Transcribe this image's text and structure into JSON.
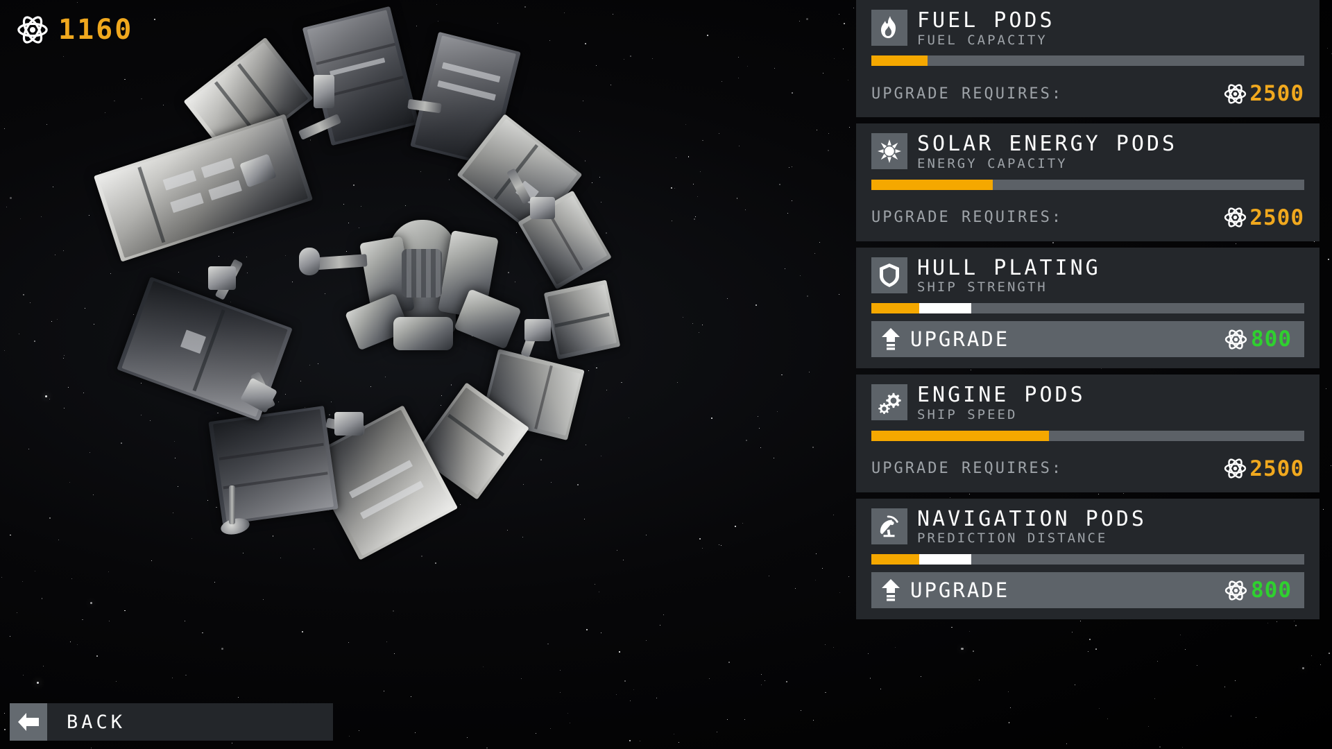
{
  "hud": {
    "currency_icon": "atom-icon",
    "currency_amount": "1160"
  },
  "back_button": {
    "label": "BACK",
    "icon": "arrow-left-icon"
  },
  "colors": {
    "accent_gold": "#f5a800",
    "cost_gold": "#f0a81e",
    "affordable_green": "#2fd02f",
    "panel_bg": "#24272b",
    "icon_bg": "#5d6369",
    "bar_track": "#5c6167",
    "bar_preview": "#ffffff",
    "subtitle": "#9ea3a8"
  },
  "labels": {
    "upgrade_requires": "UPGRADE REQUIRES:",
    "upgrade": "UPGRADE"
  },
  "panels": [
    {
      "id": "fuel-pods",
      "title": "FUEL PODS",
      "subtitle": "FUEL CAPACITY",
      "icon": "flame-icon",
      "bar_fill_pct": 13,
      "bar_preview_pct": 0,
      "state": "locked",
      "requires_label": "UPGRADE REQUIRES:",
      "cost": "2500",
      "cost_color": "#f0a81e"
    },
    {
      "id": "solar-energy-pods",
      "title": "SOLAR ENERGY PODS",
      "subtitle": "ENERGY CAPACITY",
      "icon": "sun-icon",
      "bar_fill_pct": 28,
      "bar_preview_pct": 0,
      "state": "locked",
      "requires_label": "UPGRADE REQUIRES:",
      "cost": "2500",
      "cost_color": "#f0a81e"
    },
    {
      "id": "hull-plating",
      "title": "HULL PLATING",
      "subtitle": "SHIP STRENGTH",
      "icon": "shield-icon",
      "bar_fill_pct": 11,
      "bar_preview_pct": 12,
      "state": "upgradable",
      "button_label": "UPGRADE",
      "cost": "800",
      "cost_color": "#2fd02f"
    },
    {
      "id": "engine-pods",
      "title": "ENGINE PODS",
      "subtitle": "SHIP SPEED",
      "icon": "gears-icon",
      "bar_fill_pct": 41,
      "bar_preview_pct": 0,
      "state": "locked",
      "requires_label": "UPGRADE REQUIRES:",
      "cost": "2500",
      "cost_color": "#f0a81e"
    },
    {
      "id": "navigation-pods",
      "title": "NAVIGATION PODS",
      "subtitle": "PREDICTION DISTANCE",
      "icon": "satellite-dish-icon",
      "bar_fill_pct": 11,
      "bar_preview_pct": 12,
      "state": "upgradable",
      "button_label": "UPGRADE",
      "cost": "800",
      "cost_color": "#2fd02f"
    }
  ]
}
